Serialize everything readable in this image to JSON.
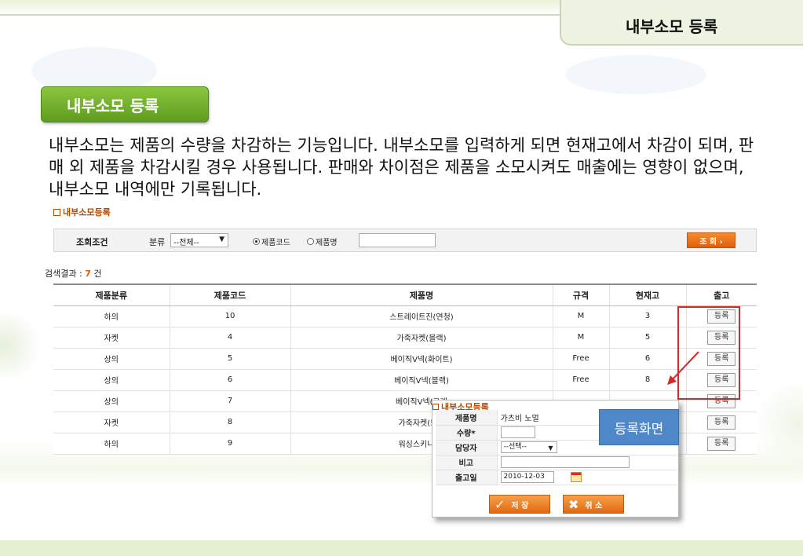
{
  "header": {
    "title": "내부소모 등록"
  },
  "section": {
    "button_label": "내부소모 등록",
    "description": "내부소모는 제품의 수량을 차감하는 기능입니다. 내부소모를 입력하게 되면 현재고에서 차감이 되며, 판매 외 제품을 차감시킬 경우 사용됩니다. 판매와 차이점은 제품을 소모시켜도 매출에는 영향이 없으며, 내부소모 내역에만 기록됩니다.",
    "form_title": "내부소모등록"
  },
  "search": {
    "label": "조회조건",
    "category_label": "분류",
    "category_value": "--전체--",
    "radio_code": "제품코드",
    "radio_name": "제품명",
    "query_button": "조 회 ›"
  },
  "result": {
    "prefix": "검색결과 :",
    "count": "7",
    "suffix": "건"
  },
  "table": {
    "headers": [
      "제품분류",
      "제품코드",
      "제품명",
      "규격",
      "현재고",
      "출고"
    ],
    "rows": [
      [
        "하의",
        "10",
        "스트레이트진(연청)",
        "M",
        "3",
        "등록"
      ],
      [
        "자켓",
        "4",
        "가죽자켓(블랙)",
        "M",
        "5",
        "등록"
      ],
      [
        "상의",
        "5",
        "베이직V넥(화이트)",
        "Free",
        "6",
        "등록"
      ],
      [
        "상의",
        "6",
        "베이직V넥(블랙)",
        "Free",
        "8",
        "등록"
      ],
      [
        "상의",
        "7",
        "베이직V넥(그레",
        "",
        "",
        "등록"
      ],
      [
        "자켓",
        "8",
        "가죽자켓(브라",
        "",
        "",
        "등록"
      ],
      [
        "하의",
        "9",
        "워싱스키니(중",
        "",
        "",
        "등록"
      ]
    ]
  },
  "popup": {
    "title": "내부소모등록",
    "product_label": "제품명",
    "product_value": "가츠비 노멀",
    "qty_label": "수량*",
    "manager_label": "담당자",
    "manager_value": "--선택--",
    "note_label": "비고",
    "date_label": "출고일",
    "date_value": "2010-12-03",
    "save_label": "저 장",
    "cancel_label": "취 소"
  },
  "callout": {
    "label": "등록화면"
  },
  "colors": {
    "accent_green": "#6aaa28",
    "accent_orange": "#e66a12",
    "highlight_red": "#d42a2a",
    "callout_blue": "#4e88c8"
  }
}
